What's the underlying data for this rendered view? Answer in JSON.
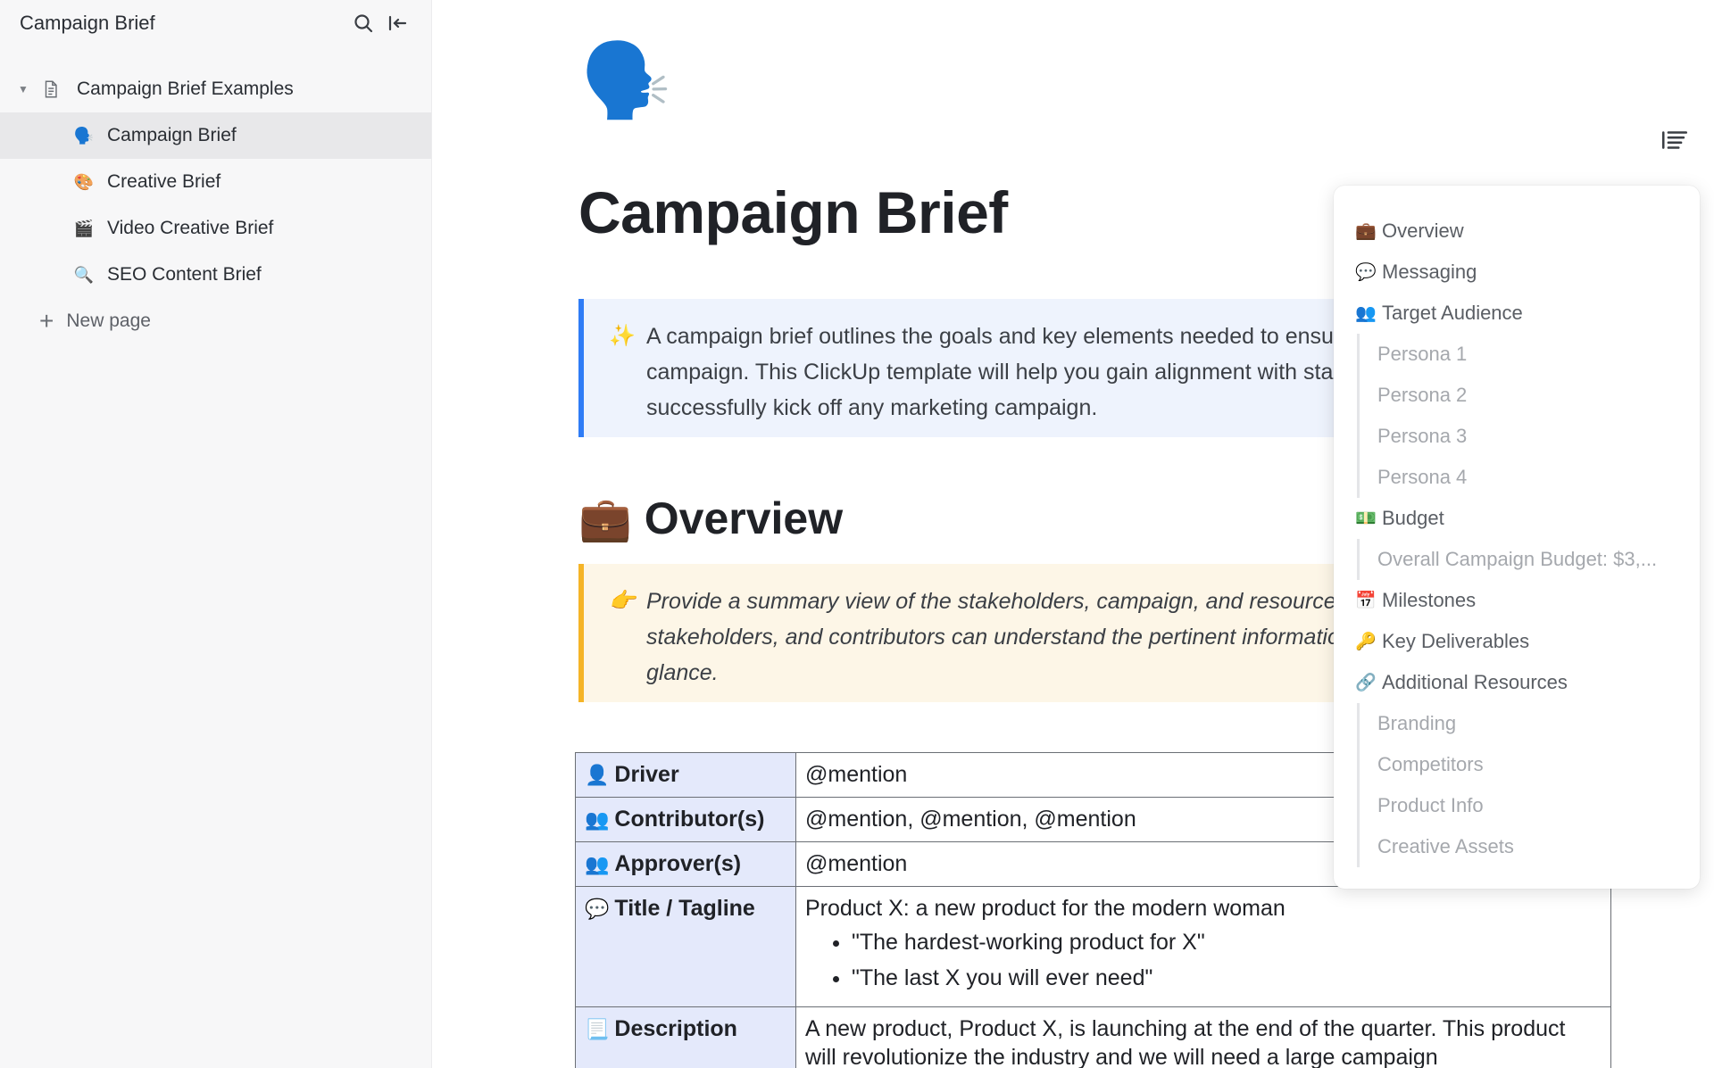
{
  "sidebar": {
    "title": "Campaign Brief",
    "icons": {
      "search": "search-icon",
      "collapse": "collapse-sidebar-icon"
    },
    "parent": {
      "label": "Campaign Brief Examples",
      "icon": "document-icon"
    },
    "items": [
      {
        "label": "Campaign Brief",
        "emoji": "🗣️",
        "active": true
      },
      {
        "label": "Creative Brief",
        "emoji": "🎨"
      },
      {
        "label": "Video Creative Brief",
        "emoji": "🎬"
      },
      {
        "label": "SEO Content Brief",
        "emoji": "🔍"
      }
    ],
    "new_page": "New page"
  },
  "page": {
    "emoji": "🗣️",
    "title": "Campaign Brief",
    "intro_emoji": "✨",
    "intro": "A campaign brief outlines the goals and key elements needed to ensure a successful campaign. This ClickUp template will help you gain alignment with stakeholders and successfully kick off any marketing campaign.",
    "overview_emoji": "💼",
    "overview_heading": "Overview",
    "overview_note_emoji": "👉",
    "overview_note": "Provide a summary view of the stakeholders, campaign, and resources so that Leadership, stakeholders, and contributors can understand the pertinent information of the campaign at a glance."
  },
  "table": {
    "rows": [
      {
        "emoji": "👤",
        "key": "Driver",
        "value": "@mention"
      },
      {
        "emoji": "👥",
        "key": "Contributor(s)",
        "value": "@mention, @mention, @mention"
      },
      {
        "emoji": "👥",
        "key": "Approver(s)",
        "value": "@mention"
      },
      {
        "emoji": "💬",
        "key": "Title / Tagline",
        "value": "Product X: a new product for the modern woman",
        "bullets": [
          "\"The hardest-working product for X\"",
          "\"The last X you will ever need\""
        ]
      },
      {
        "emoji": "📃",
        "key": "Description",
        "value": "A new product, Product X, is launching at the end of the quarter. This product will revolutionize the industry and we will need a large campaign"
      }
    ]
  },
  "toc": {
    "items": [
      {
        "emoji": "💼",
        "label": "Overview",
        "level": 1
      },
      {
        "emoji": "💬",
        "label": "Messaging",
        "level": 1
      },
      {
        "emoji": "👥",
        "label": "Target Audience",
        "level": 1
      },
      {
        "label": "Persona 1",
        "level": 2
      },
      {
        "label": "Persona 2",
        "level": 2
      },
      {
        "label": "Persona 3",
        "level": 2
      },
      {
        "label": "Persona 4",
        "level": 2
      },
      {
        "emoji": "💵",
        "label": "Budget",
        "level": 1
      },
      {
        "label": "Overall Campaign Budget: $3,...",
        "level": 2
      },
      {
        "emoji": "📅",
        "label": "Milestones",
        "level": 1
      },
      {
        "emoji": "🔑",
        "label": "Key Deliverables",
        "level": 1
      },
      {
        "emoji": "🔗",
        "label": "Additional Resources",
        "level": 1
      },
      {
        "label": "Branding",
        "level": 2
      },
      {
        "label": "Competitors",
        "level": 2
      },
      {
        "label": "Product Info",
        "level": 2
      },
      {
        "label": "Creative Assets",
        "level": 2
      }
    ]
  }
}
